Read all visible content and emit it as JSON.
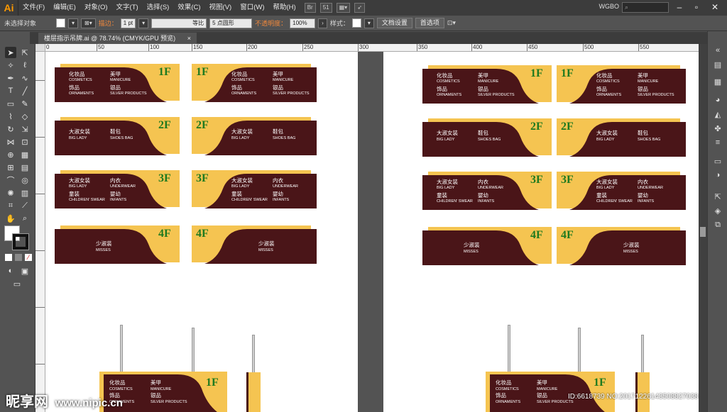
{
  "app": {
    "logo": "Ai",
    "workspace": "WGBO",
    "search_placeholder": "",
    "view_badge": "51"
  },
  "menu": [
    "文件(F)",
    "编辑(E)",
    "对象(O)",
    "文字(T)",
    "选择(S)",
    "效果(C)",
    "视图(V)",
    "窗口(W)",
    "帮助(H)"
  ],
  "control_bar": {
    "selection_label": "未选择对象",
    "stroke_label": "描边：",
    "stroke_weight": "1 pt",
    "profile_label": "等比",
    "brush_label": "5 点圆形",
    "opacity_label": "不透明度：",
    "opacity_value": "100%",
    "style_label": "样式：",
    "doc_setup": "文档设置",
    "preferences": "首选项"
  },
  "document_tab": {
    "title": "楼层指示吊牌.ai @ 78.74% (CMYK/GPU 预览)",
    "close": "×"
  },
  "ruler": {
    "marks": [
      "0",
      "50",
      "100",
      "150",
      "200",
      "250",
      "300",
      "350",
      "400",
      "450",
      "500",
      "550"
    ]
  },
  "signs": {
    "floors": [
      "1F",
      "2F",
      "3F",
      "4F"
    ],
    "f1": {
      "cn1": "化妆品",
      "en1": "COSMETICS",
      "cn2": "美甲",
      "en2": "MANICURE",
      "cn3": "饰品",
      "en3": "ORNAMENTS",
      "cn4": "银品",
      "en4": "SILVER PRODUCTS"
    },
    "f2": {
      "cn1": "大淑女装",
      "en1": "BIG LADY",
      "cn2": "鞋包",
      "en2": "SHOES BAG"
    },
    "f3": {
      "cn1": "大淑女装",
      "en1": "BIG LADY",
      "cn2": "内衣",
      "en2": "UNDERWEAR",
      "cn3": "童装",
      "en3": "CHILDREN' SWEAR",
      "cn4": "婴幼",
      "en4": "INFANTS"
    },
    "f4": {
      "cn1": "少淑装",
      "en1": "MISSES"
    }
  },
  "colors": {
    "maroon": "#4a1518",
    "gold": "#f5c451",
    "floor_green": "#1f7a1f"
  },
  "watermark": {
    "brand": "昵享网",
    "url": "www.nipic.cn",
    "id": "ID:6618739 NO:20171226143508827038"
  }
}
